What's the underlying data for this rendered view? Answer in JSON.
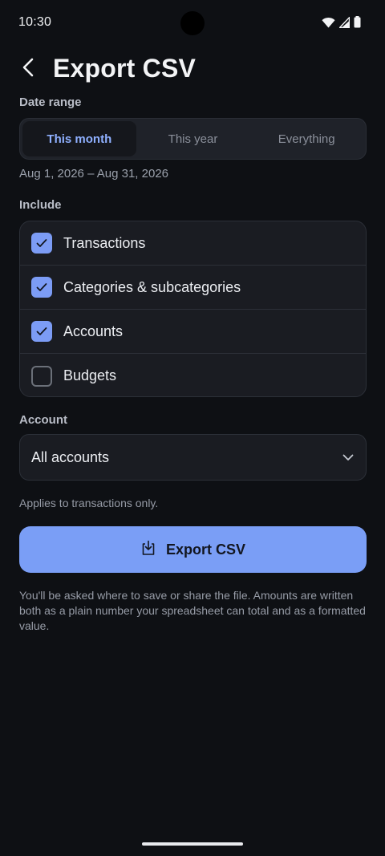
{
  "status_bar": {
    "time": "10:30",
    "icons": [
      "wifi-icon",
      "signal-icon",
      "battery-icon"
    ]
  },
  "app_bar": {
    "back_icon": "back-arrow-icon",
    "title": "Export CSV"
  },
  "date_range": {
    "label": "Date range",
    "options": [
      "This month",
      "This year",
      "Everything"
    ],
    "selected": "This month",
    "range_text": "Aug 1, 2026 – Aug 31, 2026"
  },
  "include": {
    "label": "Include",
    "items": [
      {
        "label": "Transactions",
        "checked": true
      },
      {
        "label": "Categories & subcategories",
        "checked": true
      },
      {
        "label": "Accounts",
        "checked": true
      },
      {
        "label": "Budgets",
        "checked": false
      }
    ]
  },
  "account": {
    "label": "Account",
    "value": "All accounts",
    "hint": "Applies to transactions only."
  },
  "export": {
    "button_label": "Export CSV",
    "icon": "download-icon",
    "footnote": "You'll be asked where to save or share the file. Amounts are written both as a plain number your spreadsheet can total and as a formatted value."
  },
  "colors": {
    "background": "#0e1014",
    "accent": "#7a9ef6",
    "selected_segment_text": "#8fb0ff",
    "checkbox_checked": "#7c9cf5"
  }
}
